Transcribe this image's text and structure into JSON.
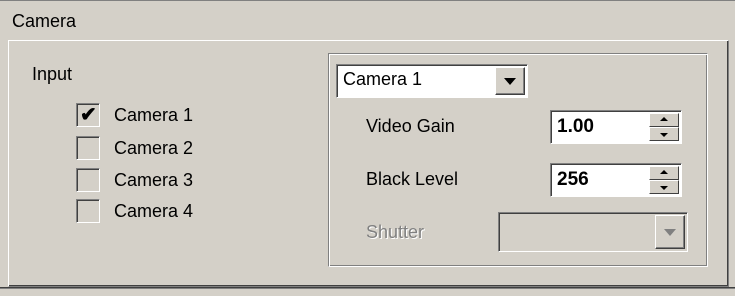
{
  "section": {
    "title": "Camera"
  },
  "input": {
    "label": "Input",
    "cameras": [
      {
        "label": "Camera 1",
        "checked": true
      },
      {
        "label": "Camera 2",
        "checked": false
      },
      {
        "label": "Camera 3",
        "checked": false
      },
      {
        "label": "Camera 4",
        "checked": false
      }
    ],
    "check_glyph": "✔"
  },
  "settings": {
    "camera_select": {
      "value": "Camera 1"
    },
    "video_gain": {
      "label": "Video Gain",
      "value": "1.00"
    },
    "black_level": {
      "label": "Black Level",
      "value": "256"
    },
    "shutter": {
      "label": "Shutter",
      "value": "",
      "disabled": true
    }
  }
}
